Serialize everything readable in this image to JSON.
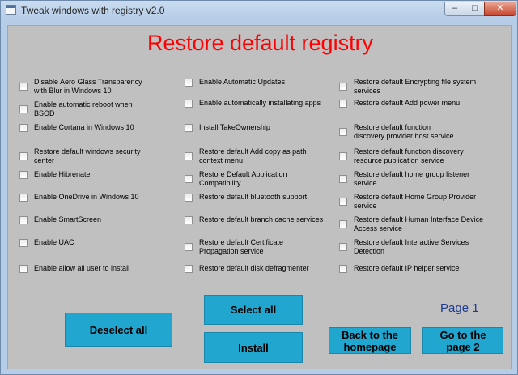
{
  "window": {
    "title": "Tweak windows with registry v2.0",
    "minimize_glyph": "–",
    "maximize_glyph": "□",
    "close_glyph": "✕"
  },
  "heading": "Restore default registry",
  "columns": [
    {
      "items": [
        {
          "id": "disable-aero-glass",
          "lines": [
            "Disable Aero Glass Transparency",
            "with Blur in Windows 10"
          ],
          "checked": false
        },
        {
          "id": "auto-reboot-bsod",
          "lines": [
            "Enable automatic reboot when",
            "BSOD"
          ],
          "checked": false
        },
        {
          "id": "cortana",
          "lines": [
            "Enable Cortana in Windows 10"
          ],
          "checked": false
        },
        {
          "id": "windows-security-center",
          "lines": [
            "Restore default windows security",
            "center"
          ],
          "checked": false
        },
        {
          "id": "hibernate",
          "lines": [
            "Enable Hibrenate"
          ],
          "checked": false
        },
        {
          "id": "onedrive",
          "lines": [
            "Enable OneDrive in Windows 10"
          ],
          "checked": false
        },
        {
          "id": "smartscreen",
          "lines": [
            "Enable SmartScreen"
          ],
          "checked": false
        },
        {
          "id": "uac",
          "lines": [
            "Enable UAC"
          ],
          "checked": false
        },
        {
          "id": "allow-all-install",
          "lines": [
            "Enable allow all user to install"
          ],
          "checked": false
        }
      ]
    },
    {
      "items": [
        {
          "id": "automatic-updates",
          "lines": [
            "Enable Automatic Updates"
          ],
          "checked": false
        },
        {
          "id": "auto-install-apps",
          "lines": [
            "Enable automatically installating apps"
          ],
          "checked": false
        },
        {
          "id": "takeownership",
          "lines": [
            "Install TakeOwnership"
          ],
          "checked": false
        },
        {
          "id": "copy-as-path",
          "lines": [
            "Restore default Add copy as path",
            "context menu"
          ],
          "checked": false
        },
        {
          "id": "app-compatibility",
          "lines": [
            "Restore Default Application",
            "Compatibility"
          ],
          "checked": false
        },
        {
          "id": "bluetooth-support",
          "lines": [
            "Restore default bluetooth support"
          ],
          "checked": false
        },
        {
          "id": "branch-cache",
          "lines": [
            "Restore default branch cache services"
          ],
          "checked": false
        },
        {
          "id": "certificate-propagation",
          "lines": [
            "Restore default Certificate",
            "Propagation service"
          ],
          "checked": false
        },
        {
          "id": "disk-defragmenter",
          "lines": [
            "Restore default disk defragmenter"
          ],
          "checked": false
        }
      ]
    },
    {
      "items": [
        {
          "id": "encrypting-fs",
          "lines": [
            "Restore default Encrypting file system",
            "services"
          ],
          "checked": false
        },
        {
          "id": "power-menu",
          "lines": [
            "Restore default Add power menu"
          ],
          "checked": false
        },
        {
          "id": "fd-provider-host",
          "lines": [
            "Restore default function",
            "discovery provider host service"
          ],
          "checked": false
        },
        {
          "id": "fd-resource-publication",
          "lines": [
            "Restore default function discovery",
            "resource publication service"
          ],
          "checked": false
        },
        {
          "id": "homegroup-listener",
          "lines": [
            "Restore default home group listener",
            "service"
          ],
          "checked": false
        },
        {
          "id": "homegroup-provider",
          "lines": [
            "Restore default Home Group Provider",
            "service"
          ],
          "checked": false
        },
        {
          "id": "hid-access",
          "lines": [
            "Restore default Human Interface Device",
            "Access service"
          ],
          "checked": false
        },
        {
          "id": "interactive-services",
          "lines": [
            "Restore default Interactive Services",
            "Detection"
          ],
          "checked": false
        },
        {
          "id": "ip-helper",
          "lines": [
            "Restore default IP helper service"
          ],
          "checked": false
        }
      ]
    }
  ],
  "buttons": {
    "deselect_all": "Deselect all",
    "select_all": "Select all",
    "install": "Install",
    "back_line1": "Back to the",
    "back_line2": "homepage",
    "next_line1": "Go to the",
    "next_line2": "page 2"
  },
  "page_label": "Page 1",
  "colors": {
    "heading": "#ff0000",
    "button_fill": "#21a6cf",
    "page_label": "#1d3b8f",
    "client_bg": "#c0c0c0",
    "frame": "#b5cde6"
  }
}
